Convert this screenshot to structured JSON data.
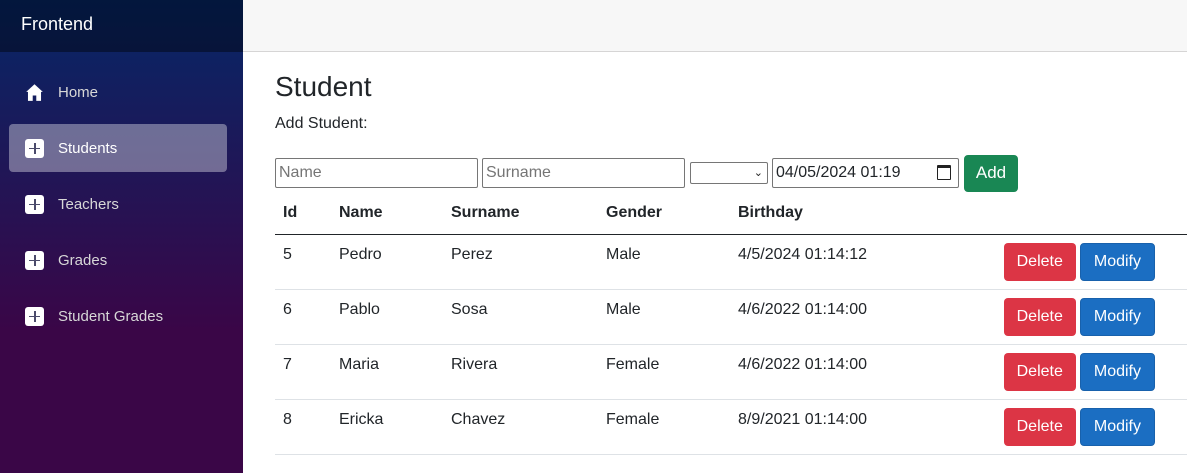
{
  "brand": "Frontend",
  "sidebar": {
    "items": [
      {
        "label": "Home",
        "icon": "home-icon"
      },
      {
        "label": "Students",
        "icon": "plus-icon"
      },
      {
        "label": "Teachers",
        "icon": "plus-icon"
      },
      {
        "label": "Grades",
        "icon": "plus-icon"
      },
      {
        "label": "Student Grades",
        "icon": "plus-icon"
      }
    ],
    "active": "Students"
  },
  "page": {
    "title": "Student",
    "subtitle": "Add Student:"
  },
  "form": {
    "name_placeholder": "Name",
    "surname_placeholder": "Surname",
    "gender_value": "",
    "birthday_value": "04/05/2024 01:19",
    "add_label": "Add"
  },
  "table": {
    "columns": [
      "Id",
      "Name",
      "Surname",
      "Gender",
      "Birthday"
    ],
    "rows": [
      {
        "id": "5",
        "name": "Pedro",
        "surname": "Perez",
        "gender": "Male",
        "birthday": "4/5/2024 01:14:12"
      },
      {
        "id": "6",
        "name": "Pablo",
        "surname": "Sosa",
        "gender": "Male",
        "birthday": "4/6/2022 01:14:00"
      },
      {
        "id": "7",
        "name": "Maria",
        "surname": "Rivera",
        "gender": "Female",
        "birthday": "4/6/2022 01:14:00"
      },
      {
        "id": "8",
        "name": "Ericka",
        "surname": "Chavez",
        "gender": "Female",
        "birthday": "8/9/2021 01:14:00"
      }
    ],
    "delete_label": "Delete",
    "modify_label": "Modify"
  },
  "colors": {
    "sidebar_top": "#052767",
    "sidebar_bottom": "#3a0647",
    "add": "#198754",
    "delete": "#dc3545",
    "modify": "#1b6ec2"
  }
}
